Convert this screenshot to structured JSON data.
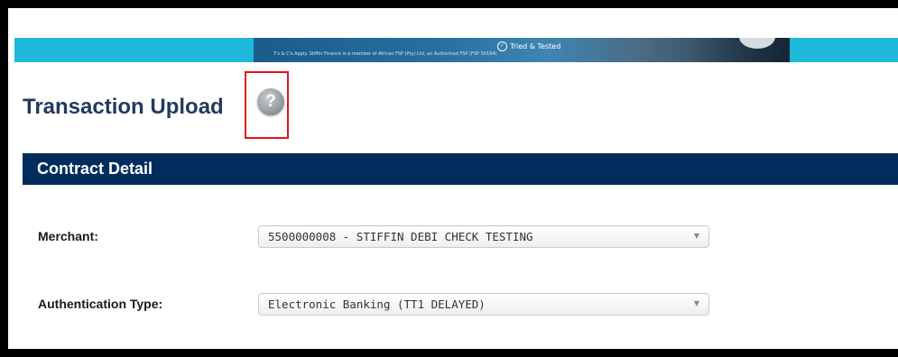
{
  "banner": {
    "fine_print": "T's & C's Apply. Stiffin Finance is a member of African FSP (Pty) Ltd, an Authorised FSP (FSP 50184)",
    "badge_label": "Tried & Tested"
  },
  "page": {
    "title": "Transaction Upload",
    "help_icon_glyph": "?"
  },
  "section": {
    "title": "Contract Detail"
  },
  "form": {
    "merchant": {
      "label": "Merchant:",
      "value": "5500000008 - STIFFIN DEBI CHECK TESTING"
    },
    "authentication_type": {
      "label": "Authentication Type:",
      "value": "Electronic Banking (TT1 DELAYED)"
    }
  },
  "icons": {
    "dropdown": "chevron-down-icon",
    "help": "help-icon",
    "badge": "check-circle-icon"
  },
  "colors": {
    "banner": "#1eb8da",
    "section_header": "#002d5e",
    "title": "#1f3a5f",
    "highlight": "#e3141e"
  }
}
